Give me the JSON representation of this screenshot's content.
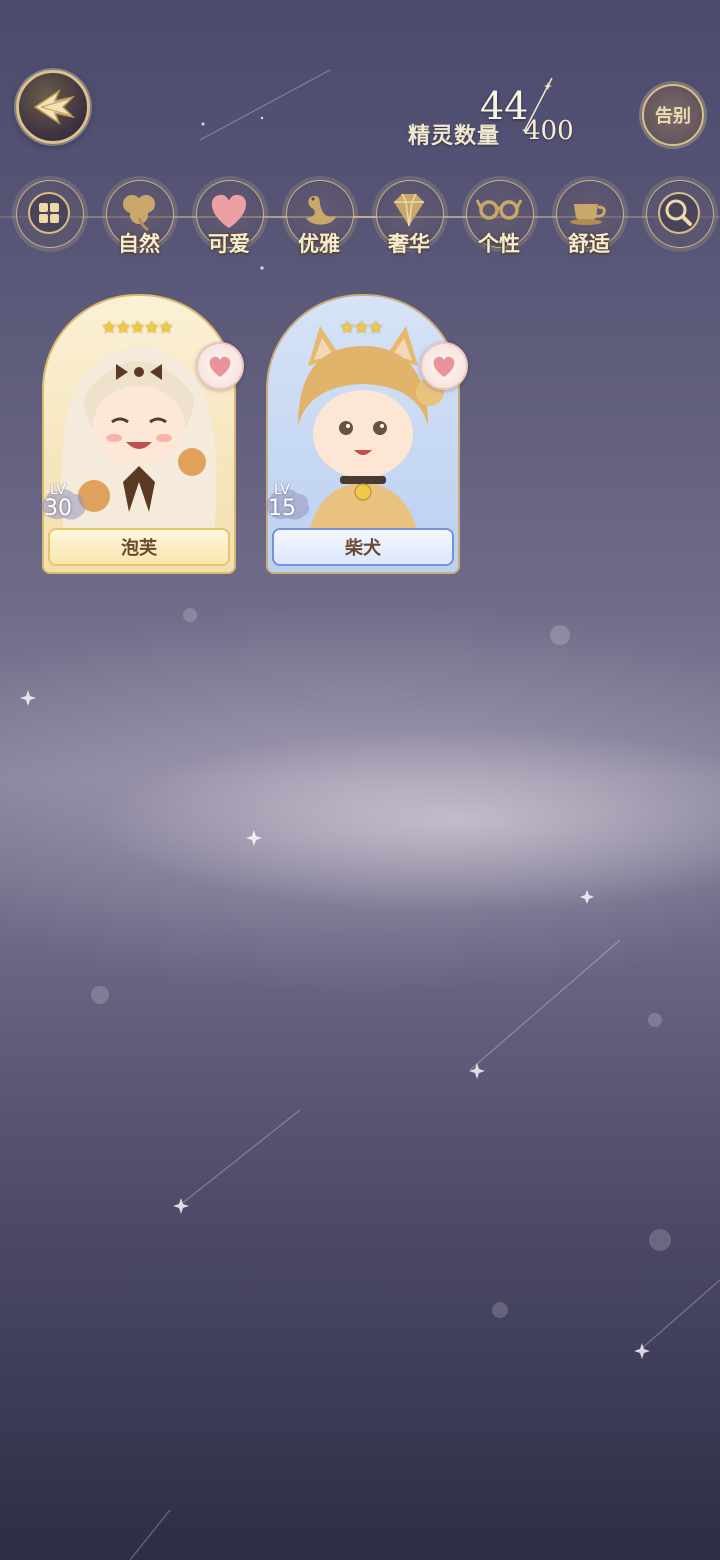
{
  "header": {
    "spirit_count_label": "精灵数量",
    "spirit_count": "44",
    "spirit_capacity": "400",
    "farewell_label": "告别"
  },
  "filters": [
    {
      "icon": "category-grid-icon",
      "label": ""
    },
    {
      "icon": "clover-icon",
      "label": "自然"
    },
    {
      "icon": "heart-icon",
      "label": "可爱"
    },
    {
      "icon": "swan-icon",
      "label": "优雅"
    },
    {
      "icon": "diamond-icon",
      "label": "奢华"
    },
    {
      "icon": "glasses-icon",
      "label": "个性"
    },
    {
      "icon": "teacup-icon",
      "label": "舒适"
    },
    {
      "icon": "search-icon",
      "label": ""
    }
  ],
  "spirits": [
    {
      "name": "泡芙",
      "level_label": "LV",
      "level": "30",
      "stars": 5,
      "rarity_color": "#e8c46a"
    },
    {
      "name": "柴犬",
      "level_label": "LV",
      "level": "15",
      "stars": 3,
      "rarity_color": "#6f86d6"
    }
  ]
}
